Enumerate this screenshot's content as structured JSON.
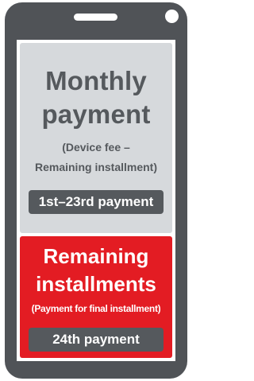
{
  "colors": {
    "phone_body": "#505357",
    "monthly_panel": "#d6d9dc",
    "remaining_panel": "#e31c23",
    "dark_text": "#55595d",
    "light_text": "#ffffff"
  },
  "monthly": {
    "title_line1": "Monthly",
    "title_line2": "payment",
    "subtitle_line1": "(Device fee –",
    "subtitle_line2": "Remaining installment)",
    "period": "1st–23rd payment"
  },
  "remaining": {
    "title_line1": "Remaining",
    "title_line2": "installments",
    "subtitle": "(Payment for final installment)",
    "period": "24th payment"
  }
}
